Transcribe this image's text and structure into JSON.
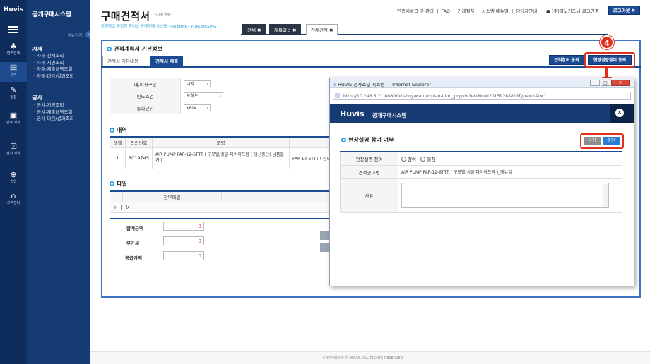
{
  "nav": {
    "logo": "Huvis",
    "items": [
      {
        "label": "협력업체",
        "icon": "people-icon"
      },
      {
        "label": "견적",
        "icon": "document-icon"
      },
      {
        "label": "입찰",
        "icon": "edit-icon"
      },
      {
        "label": "발주 계약",
        "icon": "cart-icon"
      },
      {
        "label": "전자 계약",
        "icon": "check-icon"
      },
      {
        "label": "협업",
        "icon": "globe-icon"
      },
      {
        "label": "고객센터",
        "icon": "support-icon"
      }
    ]
  },
  "sidebar": {
    "title": "공개구매시스템",
    "collapse_label": "메뉴닫기",
    "sections": [
      {
        "title": "자재",
        "items": [
          "자재-진체조회",
          "자재-지명조회",
          "자재-제출내역조회",
          "자재-마감/결과조회"
        ]
      },
      {
        "title": "공사",
        "items": [
          "공사-지명조회",
          "공사-제출내역조회",
          "공사-마감/결과조회"
        ]
      }
    ]
  },
  "header": {
    "title": "구매견적서",
    "home": "HOME",
    "subtitle": "투명하고 공정한 휴비스 공개구매 시스템 · INTERNET PURCHASING",
    "top_links": [
      "인증서발급 및 관리",
      "FAQ",
      "거래절차",
      "시스템 매뉴얼",
      "담당자안내"
    ],
    "user": "(주)이노가드님 로그인중",
    "logout": "로그아웃",
    "tabs": [
      "전체",
      "제목없음",
      "전체견적"
    ]
  },
  "page": {
    "section_title": "견적계획서 기본정보",
    "subtabs": [
      "견적서 기본내용",
      "견적서 제출"
    ],
    "btn_quote_join": "견적참여 동의",
    "btn_explain_join": "현장설명참여 동의",
    "callout": "4",
    "form": [
      {
        "label": "내,외자구분",
        "value": "내자"
      },
      {
        "label": "인도조건",
        "value": "도착도"
      },
      {
        "label": "통화단위",
        "value": "KRW"
      }
    ],
    "detail_title": "내역",
    "detail_headers": [
      "레벨",
      "의뢰번호",
      "품명"
    ],
    "detail_row": {
      "level": "1",
      "req_no": "8019745",
      "name": "AIR PUMP FAP-12-6TTT ( 구모텔/싱글 다이아프람 ) 생산중단( 납품불가 )",
      "spec": "FAP-12-6TTT ( 신모"
    },
    "file_title": "파일",
    "file_header": "첨부파일",
    "file_plus": "+",
    "file_refresh": "↻",
    "sum": [
      {
        "label": "합계금액",
        "value": "0"
      },
      {
        "label": "부가세",
        "value": "0"
      },
      {
        "label": "공급가액",
        "value": "0"
      }
    ]
  },
  "footer": "COPYRIGHT © HUVIS. ALL RIGHTS RESERVED",
  "popup": {
    "window_title": "HUVIS 전자조달 시스템 - - Internet Explorer",
    "url": "http://10.248.5.21:8080/bid-buy/wantexplanation_pop.do?estNo=I2015928&bidType=1&t=1",
    "brand": "Huvis",
    "brand_sub": "공개구매시스템",
    "section_title": "현장설명 참여 여부",
    "btn_close": "닫기",
    "btn_confirm": "확인",
    "rows": {
      "participation_label": "현장설명 참여",
      "opt_join": "참여",
      "opt_no": "불참",
      "notice_label": "견적공고명",
      "notice_value": "AIR PUMP FAP-12-6TTT ( 구모텔/싱글 다이아프람 )_매뉴얼",
      "reason_label": "사유"
    }
  }
}
